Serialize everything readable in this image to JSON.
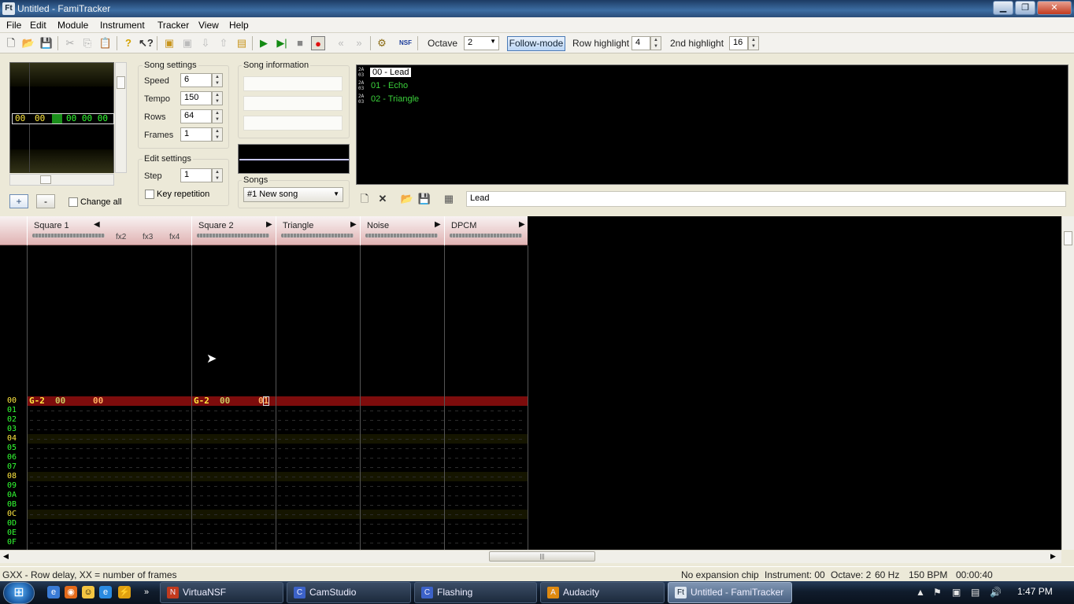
{
  "window": {
    "title": "Untitled - FamiTracker",
    "controls": [
      "▁",
      "❐",
      "✕"
    ]
  },
  "menu": [
    "File",
    "Edit",
    "Module",
    "Instrument",
    "Tracker",
    "View",
    "Help"
  ],
  "toolbar": {
    "octave_label": "Octave",
    "octave_value": "2",
    "follow_mode": "Follow-mode",
    "row_highlight_label": "Row highlight",
    "row_highlight_value": "4",
    "second_highlight_label": "2nd highlight",
    "second_highlight_value": "16"
  },
  "frame_view": {
    "cells": [
      "00",
      "00",
      "00",
      "00 00 00"
    ]
  },
  "song_settings": {
    "title": "Song settings",
    "speed_label": "Speed",
    "speed": "6",
    "tempo_label": "Tempo",
    "tempo": "150",
    "rows_label": "Rows",
    "rows": "64",
    "frames_label": "Frames",
    "frames": "1"
  },
  "edit_settings": {
    "title": "Edit settings",
    "step_label": "Step",
    "step": "1",
    "key_repetition": "Key repetition"
  },
  "song_information": {
    "title": "Song information"
  },
  "songs": {
    "label": "Songs",
    "selected": "#1 New song"
  },
  "frame_buttons": {
    "add": "+",
    "remove": "-",
    "change_all": "Change all"
  },
  "instruments": [
    {
      "label": "00 - Lead",
      "selected": true
    },
    {
      "label": "01 - Echo",
      "selected": false
    },
    {
      "label": "02 - Triangle",
      "selected": false
    }
  ],
  "instrument_name": "Lead",
  "channels": [
    {
      "name": "Square 1",
      "fx": [
        "fx2",
        "fx3",
        "fx4"
      ]
    },
    {
      "name": "Square 2",
      "fx": []
    },
    {
      "name": "Triangle",
      "fx": []
    },
    {
      "name": "Noise",
      "fx": []
    },
    {
      "name": "DPCM",
      "fx": []
    }
  ],
  "row_numbers": [
    "00",
    "01",
    "02",
    "03",
    "04",
    "05",
    "06",
    "07",
    "08",
    "09",
    "0A",
    "0B",
    "0C",
    "0D",
    "0E",
    "0F"
  ],
  "pattern_row0": {
    "sq1_note": "G-2",
    "sq1_inst": "00",
    "sq1_fx": "00",
    "sq2_note": "G-2",
    "sq2_inst": "00",
    "sq2_fx": "01"
  },
  "status": {
    "hint": "GXX - Row delay, XX = number of frames",
    "chip": "No expansion chip",
    "instrument": "Instrument: 00",
    "octave": "Octave: 2",
    "rate": "60 Hz",
    "bpm": "150 BPM",
    "time": "00:00:40"
  },
  "taskbar": {
    "tasks": [
      {
        "label": "VirtuaNSF",
        "active": false
      },
      {
        "label": "CamStudio",
        "active": false
      },
      {
        "label": "Flashing",
        "active": false
      },
      {
        "label": "Audacity",
        "active": false
      },
      {
        "label": "Untitled - FamiTracker",
        "active": true
      }
    ],
    "clock": "1:47 PM",
    "colors": {
      "accent": "#1d5fa8",
      "pattern_bg": "#000000",
      "row_cursor": "#7d0c0c",
      "note_text": "#ffe840",
      "row_number": "#33ff33"
    }
  }
}
